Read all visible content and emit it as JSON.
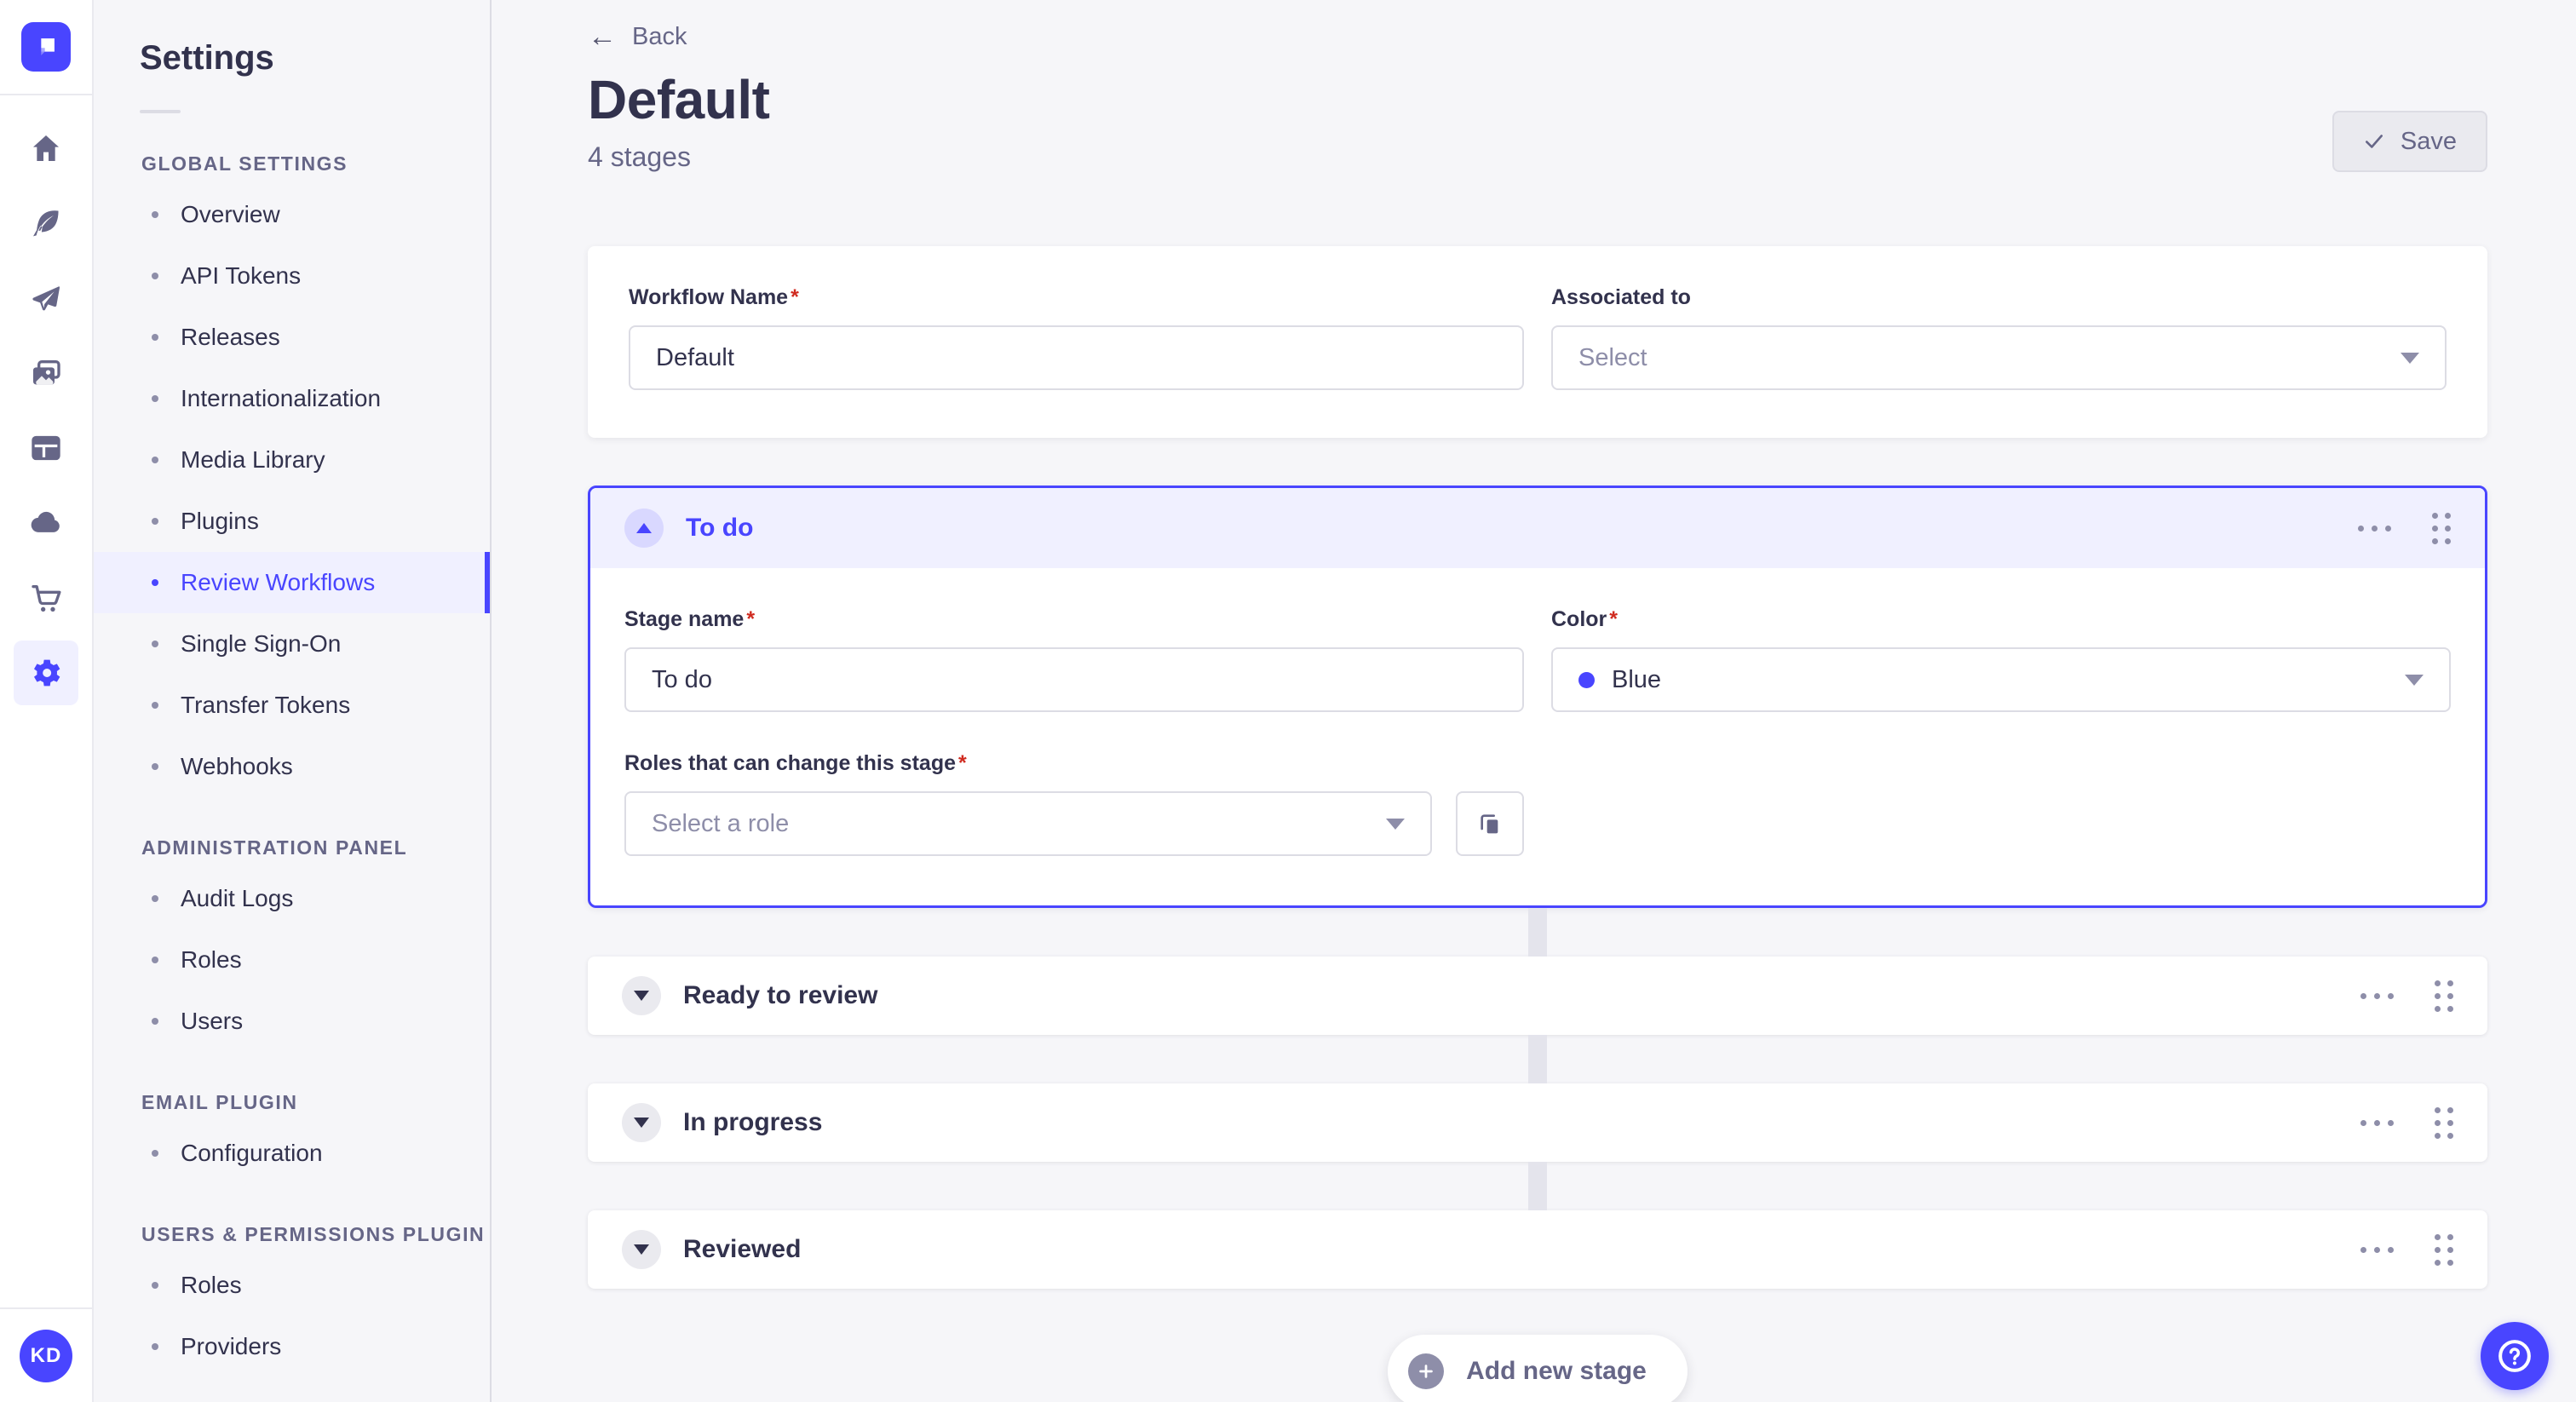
{
  "rail": {
    "avatar_initials": "KD",
    "icons": [
      {
        "name": "home"
      },
      {
        "name": "content-feather"
      },
      {
        "name": "paper-plane"
      },
      {
        "name": "media-library"
      },
      {
        "name": "layout"
      },
      {
        "name": "cloud"
      },
      {
        "name": "marketplace-cart"
      },
      {
        "name": "settings-gear",
        "active": true
      }
    ]
  },
  "subnav": {
    "title": "Settings",
    "sections": [
      {
        "label": "GLOBAL SETTINGS",
        "items": [
          {
            "label": "Overview",
            "active": false
          },
          {
            "label": "API Tokens",
            "active": false
          },
          {
            "label": "Releases",
            "active": false
          },
          {
            "label": "Internationalization",
            "active": false
          },
          {
            "label": "Media Library",
            "active": false
          },
          {
            "label": "Plugins",
            "active": false
          },
          {
            "label": "Review Workflows",
            "active": true
          },
          {
            "label": "Single Sign-On",
            "active": false
          },
          {
            "label": "Transfer Tokens",
            "active": false
          },
          {
            "label": "Webhooks",
            "active": false
          }
        ]
      },
      {
        "label": "ADMINISTRATION PANEL",
        "items": [
          {
            "label": "Audit Logs",
            "active": false
          },
          {
            "label": "Roles",
            "active": false
          },
          {
            "label": "Users",
            "active": false
          }
        ]
      },
      {
        "label": "EMAIL PLUGIN",
        "items": [
          {
            "label": "Configuration",
            "active": false
          }
        ]
      },
      {
        "label": "USERS & PERMISSIONS PLUGIN",
        "items": [
          {
            "label": "Roles",
            "active": false
          },
          {
            "label": "Providers",
            "active": false
          }
        ]
      }
    ]
  },
  "header": {
    "back_label": "Back",
    "back_arrow": "←",
    "title": "Default",
    "subtitle": "4 stages",
    "save_label": "Save"
  },
  "workflow_form": {
    "name_label": "Workflow Name",
    "name_value": "Default",
    "associated_label": "Associated to",
    "associated_placeholder": "Select",
    "required_marker": "*"
  },
  "stage_form": {
    "stage_name_label": "Stage name",
    "stage_name_value": "To do",
    "color_label": "Color",
    "color_value": "Blue",
    "color_hex": "#4945ff",
    "roles_label": "Roles that can change this stage",
    "roles_placeholder": "Select a role",
    "required_marker": "*"
  },
  "stages": [
    {
      "title": "To do",
      "expanded": true
    },
    {
      "title": "Ready to review",
      "expanded": false
    },
    {
      "title": "In progress",
      "expanded": false
    },
    {
      "title": "Reviewed",
      "expanded": false
    }
  ],
  "footer": {
    "add_stage_label": "Add new stage"
  },
  "colors": {
    "primary": "#4945ff",
    "primary_bg": "#f0f0ff",
    "disabled_button_bg": "#eaeaef",
    "danger": "#d02b20"
  }
}
